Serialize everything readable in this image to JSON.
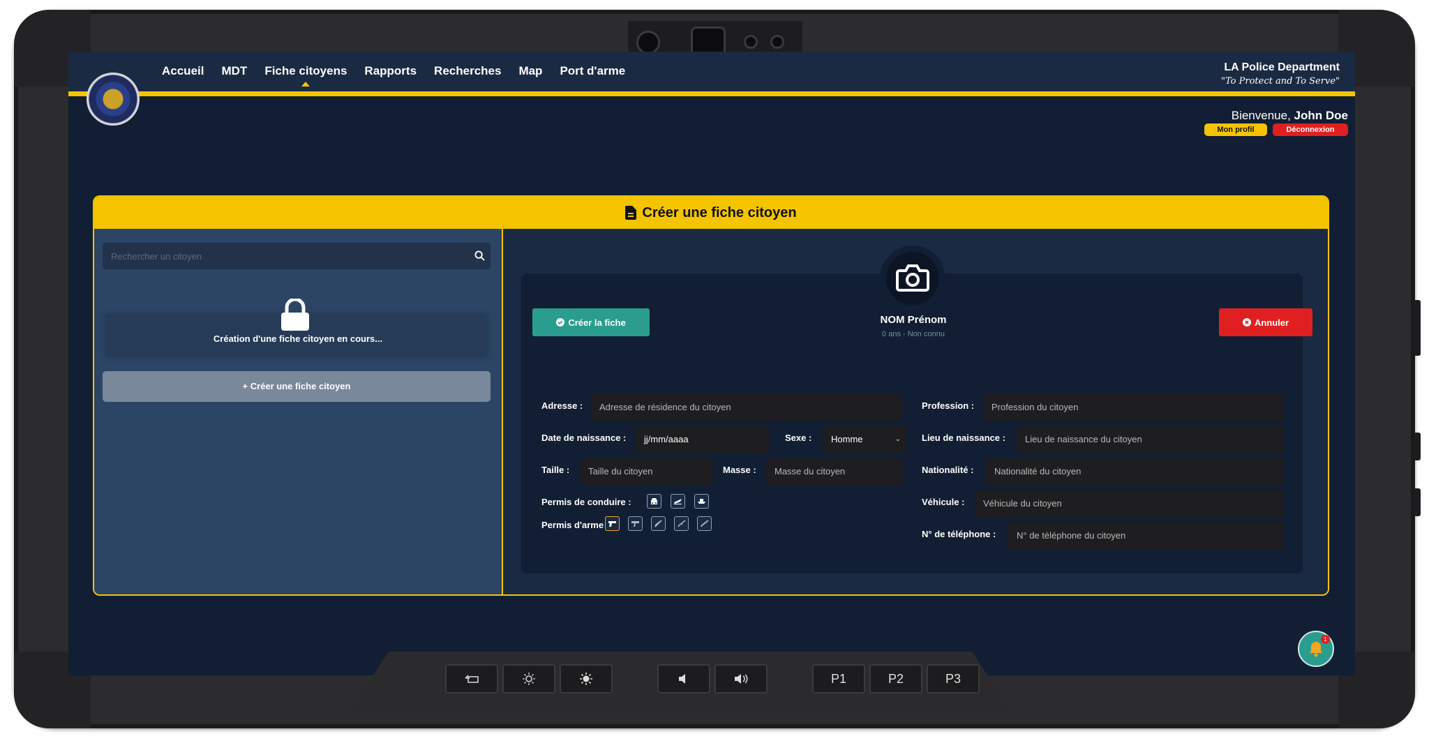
{
  "nav": {
    "items": [
      {
        "label": "Accueil"
      },
      {
        "label": "MDT"
      },
      {
        "label": "Fiche citoyens",
        "active": true
      },
      {
        "label": "Rapports"
      },
      {
        "label": "Recherches"
      },
      {
        "label": "Map"
      },
      {
        "label": "Port d'arme"
      }
    ]
  },
  "brand": {
    "name": "LA Police Department",
    "motto": "\"To Protect and To Serve\""
  },
  "user": {
    "greeting": "Bienvenue,",
    "name": "John Doe",
    "profile_label": "Mon profil",
    "logout_label": "Déconnexion"
  },
  "card": {
    "title": "Créer une fiche citoyen"
  },
  "left_pane": {
    "search_placeholder": "Rechercher un citoyen",
    "lock_message": "Création d'une fiche citoyen en cours...",
    "create_label": "+ Créer une fiche citoyen"
  },
  "form": {
    "create_button": "Créer la fiche",
    "cancel_button": "Annuler",
    "name": "NOM Prénom",
    "age_info": "0 ans - Non connu",
    "fields": {
      "adresse": {
        "label": "Adresse :",
        "placeholder": "Adresse de résidence du citoyen"
      },
      "date_naissance": {
        "label": "Date de naissance :",
        "value": "jj/mm/aaaa"
      },
      "sexe": {
        "label": "Sexe :",
        "value": "Homme"
      },
      "taille": {
        "label": "Taille :",
        "placeholder": "Taille du citoyen"
      },
      "masse": {
        "label": "Masse :",
        "placeholder": "Masse du citoyen"
      },
      "permis_conduire": {
        "label": "Permis de conduire :"
      },
      "permis_arme": {
        "label": "Permis d'arme :"
      },
      "profession": {
        "label": "Profession :",
        "placeholder": "Profession du citoyen"
      },
      "lieu_naissance": {
        "label": "Lieu de naissance :",
        "placeholder": "Lieu de naissance du citoyen"
      },
      "nationalite": {
        "label": "Nationalité :",
        "placeholder": "Nationalité du citoyen"
      },
      "vehicule": {
        "label": "Véhicule :",
        "placeholder": "Véhicule du citoyen"
      },
      "telephone": {
        "label": "N° de téléphone :",
        "placeholder": "N° de téléphone du citoyen"
      }
    },
    "driving_permits": [
      "car-icon",
      "plane-icon",
      "boat-icon"
    ],
    "weapon_permits": [
      "pistol-icon",
      "smg-icon",
      "knife-icon",
      "rifle-icon",
      "shotgun-icon"
    ]
  },
  "controls": {
    "buttons": [
      "back-icon",
      "brightness-down-icon",
      "brightness-up-icon",
      "volume-down-icon",
      "volume-up-icon",
      "P1",
      "P2",
      "P3"
    ]
  },
  "notification": {
    "count": "1"
  },
  "colors": {
    "accent": "#f5c400",
    "background": "#111e33",
    "panel": "#1b2a43",
    "success": "#2a9d8f",
    "danger": "#e02020"
  }
}
